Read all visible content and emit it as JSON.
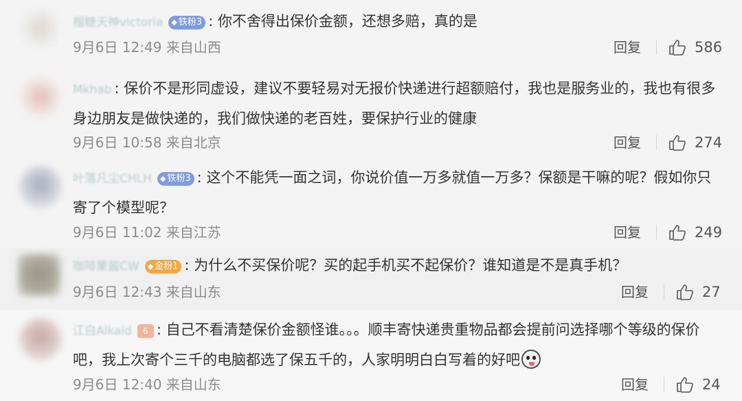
{
  "reply_label": "回复",
  "comments": [
    {
      "username": "榴糖天神victoria",
      "badge": "铁粉3",
      "text": "你不舍得出保价金额，还想多赔，真的是",
      "meta": "9月6日 12:49 来自山西",
      "likes": "586"
    },
    {
      "username": "Mkhab",
      "text": "保价不是形同虚设，建议不要轻易对无报价快递进行超额赔付，我也是服务业的，我也有很多身边朋友是做快递的，我们做快递的老百姓，要保护行业的健康",
      "meta": "9月6日 10:58 来自北京",
      "likes": "274"
    },
    {
      "username": "叶落凡尘CHLH",
      "badge": "铁粉3",
      "text": "这个不能凭一面之词，你说价值一万多就值一万多？保额是干嘛的呢？假如你只寄了个模型呢？",
      "meta": "9月6日 11:02 来自江苏",
      "likes": "249"
    },
    {
      "username": "咖啡果酱CW",
      "badge": "金粉1",
      "text": "为什么不买保价呢？买的起手机买不起保价？谁知道是不是真手机？",
      "meta": "9月6日 12:43 来自山东",
      "likes": "27"
    },
    {
      "username": "江白Alkaid",
      "vip": "6",
      "text": "自己不看清楚保价金额怪谁。。。顺丰寄快递贵重物品都会提前问选择哪个等级的保价吧，我上次寄个三千的电脑都选了保五千的，人家明明白白写着的好吧",
      "meta": "9月6日 12:40 来自山东",
      "likes": "24"
    }
  ],
  "colors": {
    "background": "#f4f4f4",
    "text": "#333333",
    "meta": "#8c8c8c",
    "iron_badge": "#7e9be5",
    "gold_badge": "#f5a742"
  },
  "icons": [
    "thumbs-up-icon",
    "diamond-icon",
    "vip-crown-icon",
    "pig-face-emoji-icon"
  ]
}
